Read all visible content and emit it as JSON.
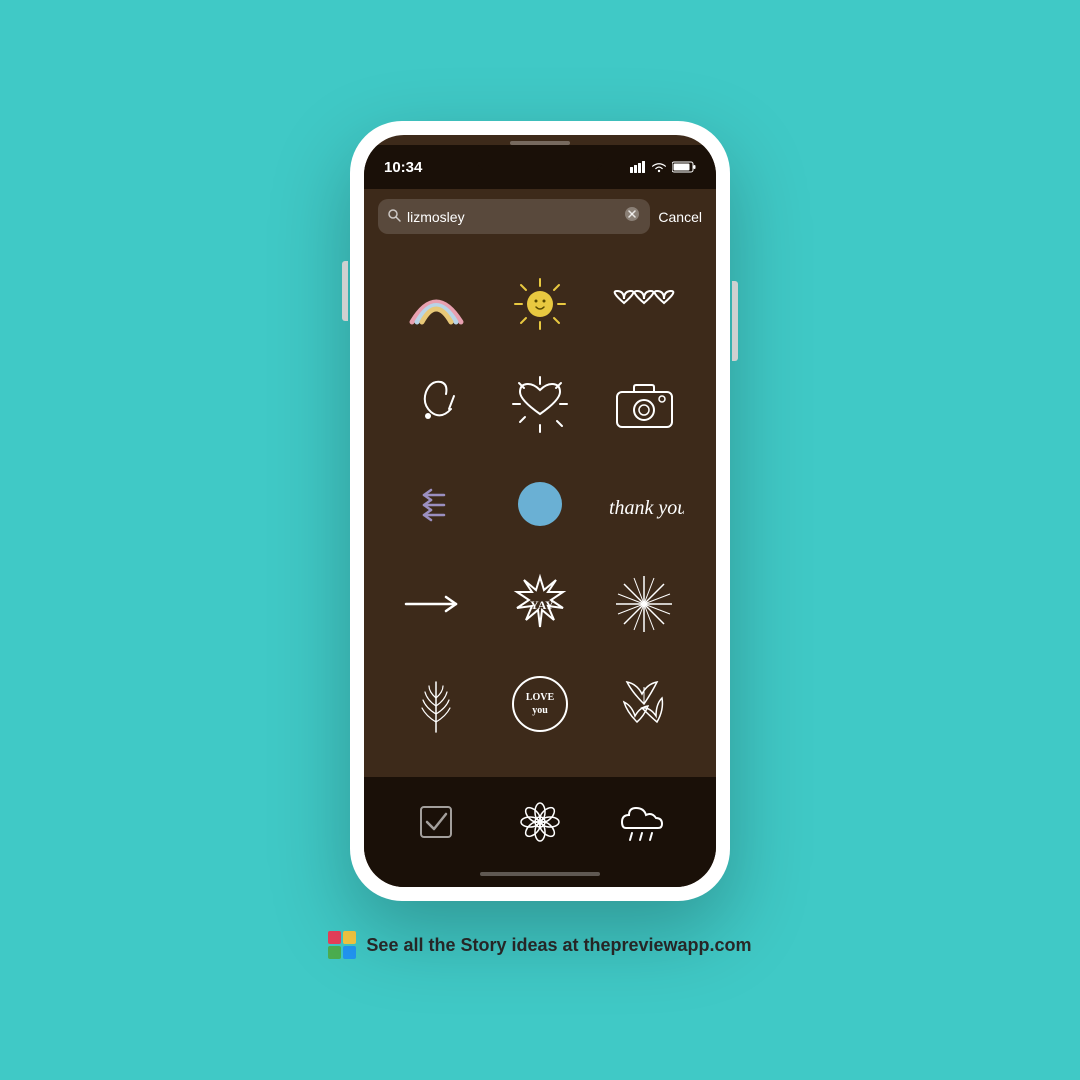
{
  "background_color": "#40c9c6",
  "phone": {
    "status_bar": {
      "time": "10:34",
      "signal": "▋▋▋",
      "wifi": "wifi",
      "battery": "battery"
    },
    "search": {
      "placeholder": "lizmosley",
      "clear_label": "✕",
      "cancel_label": "Cancel"
    },
    "stickers": {
      "rows": [
        [
          "rainbow",
          "sun-smiley",
          "hearts-trio"
        ],
        [
          "swirl-arrow",
          "shining-heart",
          "camera"
        ],
        [
          "left-arrows",
          "blue-circle",
          "thank-you"
        ],
        [
          "right-arrow",
          "yay-burst",
          "starburst"
        ],
        [
          "fern-leaf",
          "love-you-circle",
          "autumn-leaves"
        ]
      ]
    },
    "bottom_icons": [
      "checkbox",
      "flower",
      "rain-cloud"
    ]
  },
  "footer": {
    "logo": "colorful-grid",
    "text": "See all the Story ideas at thepreviewapp.com"
  }
}
